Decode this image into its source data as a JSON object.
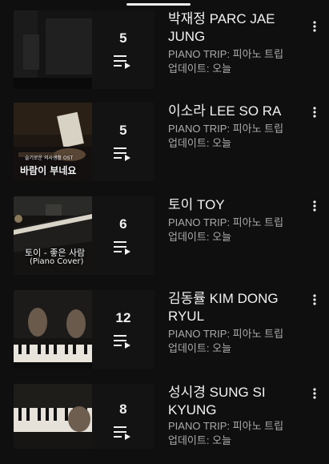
{
  "playlists": [
    {
      "title": "박재정 PARC JAE JUNG",
      "channel": "PIANO TRIP: 피아노 트립",
      "updated": "업데이트: 오늘",
      "count": "5"
    },
    {
      "title": "이소라 LEE SO RA",
      "channel": "PIANO TRIP: 피아노 트립",
      "updated": "업데이트: 오늘",
      "count": "5",
      "thumb_caption_small": "슬기로운 의사생활 OST",
      "thumb_caption": "바람이 부네요"
    },
    {
      "title": "토이 TOY",
      "channel": "PIANO TRIP: 피아노 트립",
      "updated": "업데이트: 오늘",
      "count": "6",
      "thumb_caption": "토이 - 좋은 사람",
      "thumb_caption_sub": "(Piano Cover)"
    },
    {
      "title": "김동률 KIM DONG RYUL",
      "channel": "PIANO TRIP: 피아노 트립",
      "updated": "업데이트: 오늘",
      "count": "12"
    },
    {
      "title": "성시경 SUNG SI KYUNG",
      "channel": "PIANO TRIP: 피아노 트립",
      "updated": "업데이트: 오늘",
      "count": "8"
    }
  ],
  "icons": {
    "playlist": "playlist-icon",
    "more": "more-vert-icon"
  },
  "colors": {
    "background": "#0f0f0f",
    "primary_text": "#f1f1f1",
    "secondary_text": "#aaaaaa"
  }
}
